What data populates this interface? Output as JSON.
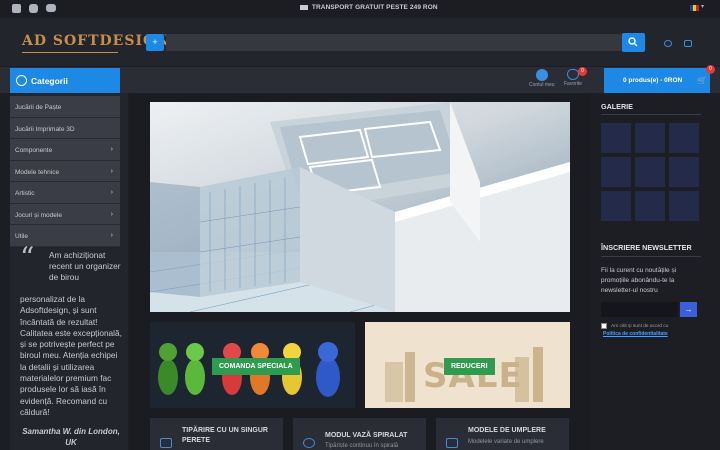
{
  "topbar": {
    "shipping_text": "TRANSPORT GRATUIT PESTE 249 RON",
    "icons": [
      "facebook-icon",
      "instagram-icon",
      "youtube-icon",
      "truck-icon",
      "flag-ro-icon"
    ]
  },
  "header": {
    "logo": "AD SOFTDESIGN"
  },
  "nav": {
    "categories_label": "Categorii",
    "account_label": "Contul meu",
    "favorites_label": "Favorite",
    "favorites_count": "0",
    "cart_label": "0 produs(e) - 0RON",
    "cart_count": "0"
  },
  "menu": {
    "items": [
      {
        "label": "Jucării de Paște",
        "arrow": ""
      },
      {
        "label": "Jucării Imprimate 3D",
        "arrow": ""
      },
      {
        "label": "Componente",
        "arrow": "›"
      },
      {
        "label": "Modele tehnice",
        "arrow": "›"
      },
      {
        "label": "Artistic",
        "arrow": "›"
      },
      {
        "label": "Jocuri și modele",
        "arrow": "›"
      },
      {
        "label": "Utile",
        "arrow": "›"
      }
    ]
  },
  "testimonial": {
    "quote_mark": "“",
    "first": "Am achiziționat recent un organizer de birou",
    "rest": "personalizat de la Adsoftdesign, și sunt încântată de rezultat! Calitatea este excepțională, și se potrivește perfect pe biroul meu. Atenția echipei la detalii și utilizarea materialelor premium fac produsele lor să iasă în evidență. Recomand cu căldură!",
    "author": "Samantha W. din London, UK"
  },
  "banners": {
    "special_order": "COMANDA SPECIALA",
    "discounts": "REDUCERI",
    "sale_word": "SALE"
  },
  "cards": [
    {
      "title": "TIPĂRIRE CU UN SINGUR PERETE",
      "subtitle": ""
    },
    {
      "title": "MODUL VAZĂ SPIRALAT",
      "subtitle": "Tipăriște continuu în spirală"
    },
    {
      "title": "MODELE DE UMPLERE",
      "subtitle": "Modelele variate de umplere"
    }
  ],
  "sidebar": {
    "gallery_title": "GALERIE",
    "newsletter_title": "ÎNSCRIERE NEWSLETTER",
    "newsletter_text": "Fii la curent cu noutățile și promoțiile abonându-te la newsletter-ul nostru",
    "agree_text": "Am citit și sunt de acord cu",
    "policy_link": "Politica de confidentialitate",
    "submit_arrow": "→"
  }
}
